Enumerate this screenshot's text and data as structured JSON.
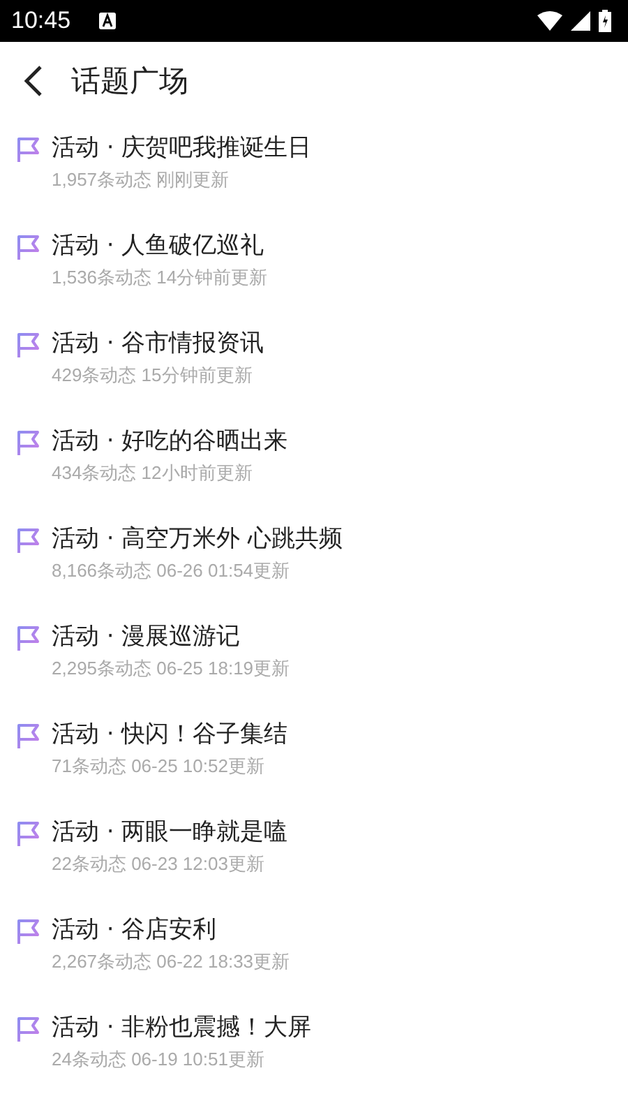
{
  "status_bar": {
    "time": "10:45"
  },
  "header": {
    "title": "话题广场"
  },
  "topics": [
    {
      "title": "活动 · 庆贺吧我推诞生日",
      "meta": "1,957条动态 刚刚更新"
    },
    {
      "title": "活动 · 人鱼破亿巡礼",
      "meta": "1,536条动态 14分钟前更新"
    },
    {
      "title": "活动 · 谷市情报资讯",
      "meta": "429条动态 15分钟前更新"
    },
    {
      "title": "活动 · 好吃的谷晒出来",
      "meta": "434条动态 12小时前更新"
    },
    {
      "title": "活动 · 高空万米外 心跳共频",
      "meta": "8,166条动态 06-26 01:54更新"
    },
    {
      "title": "活动 · 漫展巡游记",
      "meta": "2,295条动态 06-25 18:19更新"
    },
    {
      "title": "活动 · 快闪！谷子集结",
      "meta": "71条动态 06-25 10:52更新"
    },
    {
      "title": "活动 · 两眼一睁就是嗑",
      "meta": "22条动态 06-23 12:03更新"
    },
    {
      "title": "活动 · 谷店安利",
      "meta": "2,267条动态 06-22 18:33更新"
    },
    {
      "title": "活动 · 非粉也震撼！大屏",
      "meta": "24条动态 06-19 10:51更新"
    }
  ]
}
